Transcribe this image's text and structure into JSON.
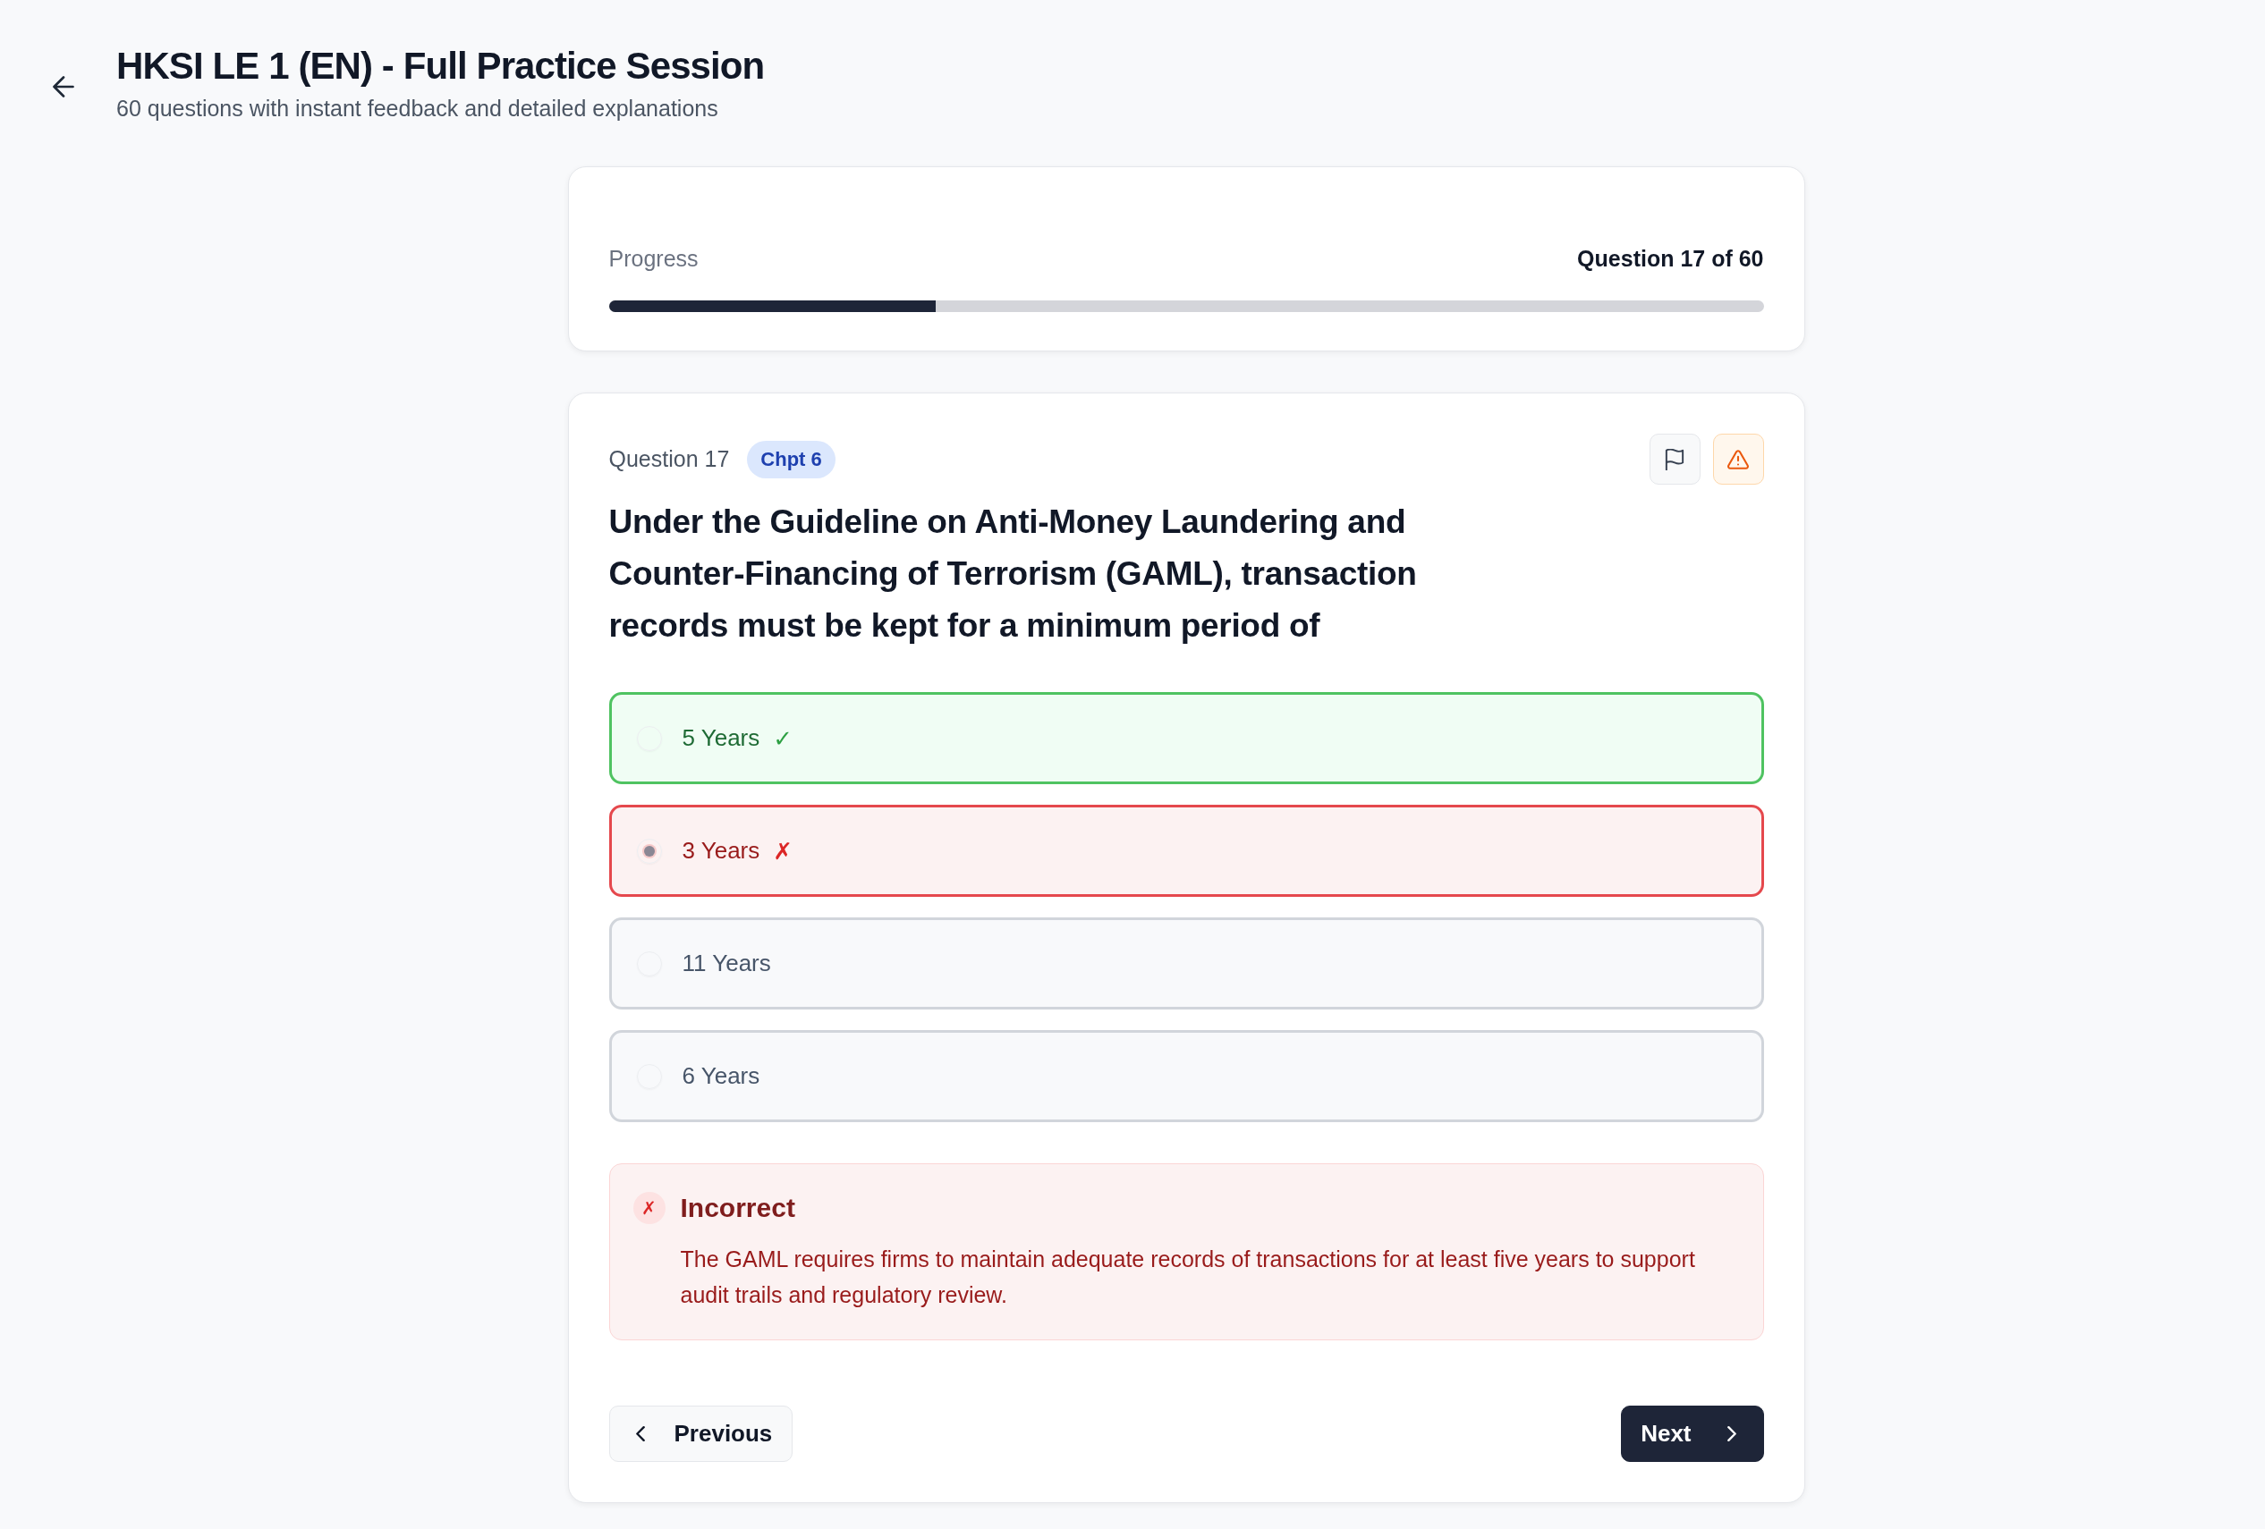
{
  "header": {
    "title": "HKSI LE 1 (EN) - Full Practice Session",
    "subtitle": "60 questions with instant feedback and detailed explanations"
  },
  "progress": {
    "label": "Progress",
    "counter": "Question 17 of 60",
    "level": 0.283
  },
  "question": {
    "number": "Question 17",
    "chapter": "Chpt 6",
    "text": "Under the Guideline on Anti-Money Laundering and Counter-Financing of Terrorism (GAML), transaction records must be kept for a minimum period of",
    "options": [
      {
        "label": "5 Years",
        "mark": "✓",
        "correct": true,
        "selected": false
      },
      {
        "label": "3 Years",
        "mark": "✗",
        "correct": false,
        "selected": true
      },
      {
        "label": "11 Years",
        "correct": false,
        "selected": false
      },
      {
        "label": "6 Years",
        "correct": false,
        "selected": false
      }
    ]
  },
  "feedback": {
    "correct": false,
    "mark": "✗",
    "title": "Incorrect",
    "text": "The GAML requires firms to maintain adequate records of transactions for at least five years to support audit trails and regulatory review."
  },
  "navigation": {
    "previous": "Previous",
    "next": "Next"
  }
}
